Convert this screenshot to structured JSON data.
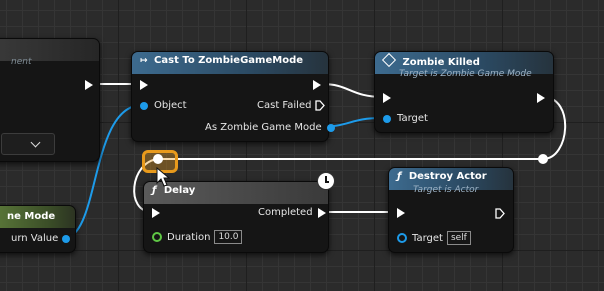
{
  "nodes": {
    "left_top": {
      "subtitle": "nent"
    },
    "left_bottom": {
      "title": "ne Mode",
      "pin_label": "urn Value"
    },
    "cast": {
      "title": "Cast To ZombieGameMode",
      "object_label": "Object",
      "cast_failed_label": "Cast Failed",
      "as_label": "As Zombie Game Mode"
    },
    "zombie_killed": {
      "title": "Zombie Killed",
      "subtitle": "Target is Zombie Game Mode",
      "target_label": "Target"
    },
    "delay": {
      "title": "Delay",
      "completed_label": "Completed",
      "duration_label": "Duration",
      "duration_value": "10.0"
    },
    "destroy_actor": {
      "title": "Destroy Actor",
      "subtitle": "Target is Actor",
      "target_label": "Target",
      "target_value": "self"
    }
  },
  "colors": {
    "exec": "#ffffff",
    "object_pin": "#1d9bea",
    "float_pin": "#5fc745",
    "highlight": "#e89a1c"
  }
}
